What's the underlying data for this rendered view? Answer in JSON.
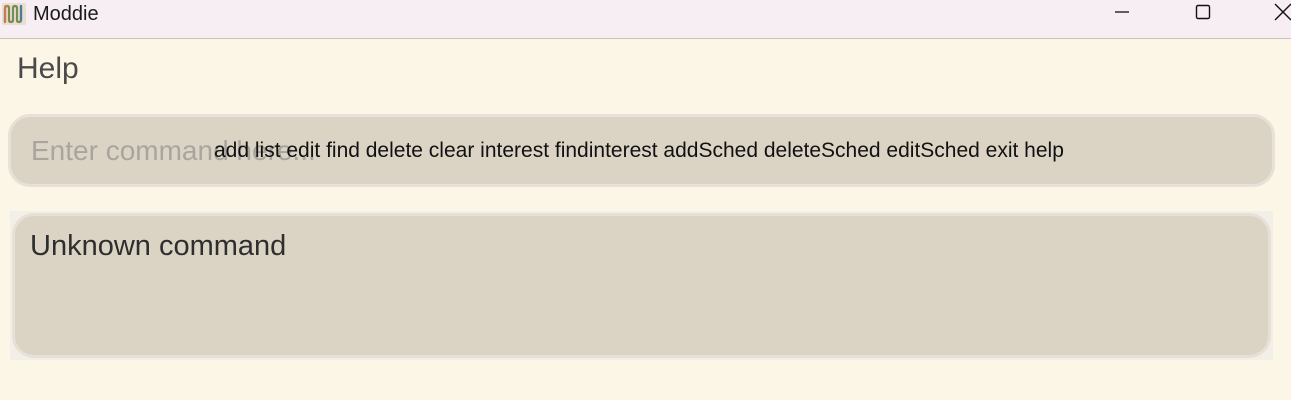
{
  "window": {
    "title": "Moddie",
    "icon": "moddie-app-icon",
    "controls": [
      "minimize-icon",
      "maximize-icon",
      "close-icon"
    ]
  },
  "menu": {
    "help_label": "Help"
  },
  "command_box": {
    "placeholder": "Enter command here...",
    "value": "",
    "suggestions": "add list edit find delete clear interest findinterest addSched deleteSched editSched exit help"
  },
  "result_display": {
    "text": "Unknown command"
  },
  "colors": {
    "background": "#fcf6e7",
    "titlebar": "#f7eef3",
    "panel": "#dbd4c5",
    "panel_border": "#e7e1d7"
  }
}
